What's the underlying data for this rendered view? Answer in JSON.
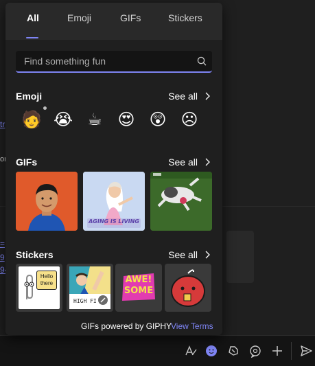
{
  "tabs": [
    {
      "label": "All",
      "active": true
    },
    {
      "label": "Emoji",
      "active": false
    },
    {
      "label": "GIFs",
      "active": false
    },
    {
      "label": "Stickers",
      "active": false
    }
  ],
  "search": {
    "placeholder": "Find something fun",
    "value": "",
    "icon": "search-icon"
  },
  "sections": {
    "emoji": {
      "title": "Emoji",
      "see_all": "See all",
      "items": [
        {
          "name": "person-emoji",
          "glyph": "🧑"
        },
        {
          "name": "loudly-crying-face-emoji",
          "glyph": "😭"
        },
        {
          "name": "hot-beverage-emoji",
          "glyph": "☕"
        },
        {
          "name": "heart-eyes-emoji",
          "glyph": "😍"
        },
        {
          "name": "astonished-face-emoji",
          "glyph": "😲"
        },
        {
          "name": "frowning-face-emoji",
          "glyph": "☹"
        }
      ]
    },
    "gifs": {
      "title": "GIFs",
      "see_all": "See all",
      "items": [
        {
          "name": "gif-man-cartoon"
        },
        {
          "name": "gif-aging-is-living",
          "caption": "AGING IS LIVING"
        },
        {
          "name": "gif-dog-lying-on-grass"
        }
      ]
    },
    "stickers": {
      "title": "Stickers",
      "see_all": "See all",
      "items": [
        {
          "name": "sticker-clippy-hello",
          "text": "Hello there"
        },
        {
          "name": "sticker-high-five",
          "text": "HIGH FI"
        },
        {
          "name": "sticker-awesome",
          "text_top": "AWE!",
          "text_bottom": "SOME"
        },
        {
          "name": "sticker-red-blob"
        }
      ]
    }
  },
  "footer": {
    "powered": "GIFs powered by GIPHY",
    "terms": "View Terms"
  },
  "background": {
    "link_fragments": [
      "tr",
      "=",
      "9",
      "94"
    ],
    "text_fragments": [
      "or"
    ]
  },
  "toolbar": {
    "items": [
      "format-icon",
      "emoji-icon",
      "loop-icon",
      "copilot-icon",
      "add-icon",
      "send-icon"
    ]
  },
  "colors": {
    "accent": "#7f85f5",
    "panel_bg": "#292929",
    "content_bg": "#1f1f1f",
    "search_bg": "#141414"
  }
}
